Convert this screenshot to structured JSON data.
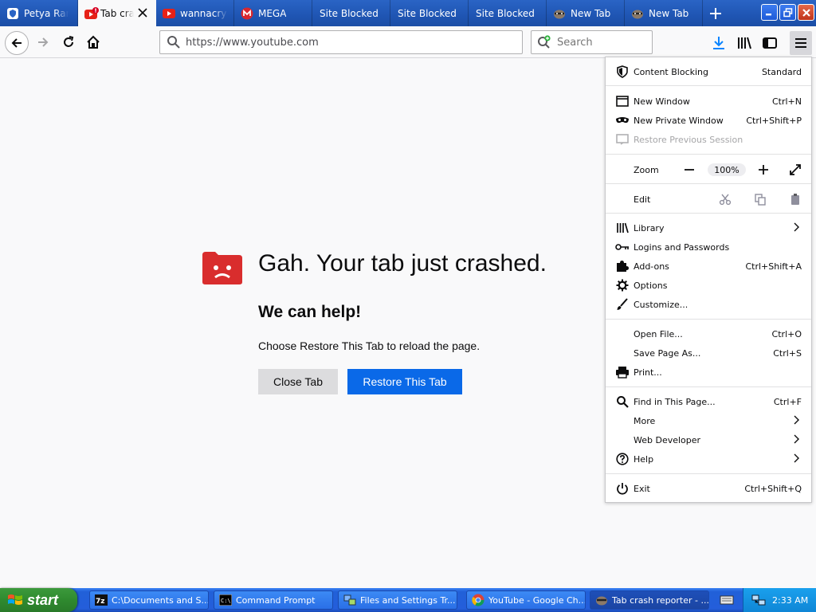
{
  "tabs": [
    {
      "title": "Petya Ransomware",
      "icon": "shield-icon"
    },
    {
      "title": "Tab crashed",
      "icon": "crashed-youtube-icon",
      "active": true
    },
    {
      "title": "wannacry download",
      "icon": "youtube-icon"
    },
    {
      "title": "MEGA",
      "icon": "mega-icon"
    },
    {
      "title": "Site Blocked",
      "icon": ""
    },
    {
      "title": "Site Blocked",
      "icon": ""
    },
    {
      "title": "Site Blocked",
      "icon": ""
    },
    {
      "title": "New Tab",
      "icon": "raccoon-icon"
    },
    {
      "title": "New Tab",
      "icon": "raccoon-icon"
    }
  ],
  "nav": {
    "url": "https://www.youtube.com",
    "search_placeholder": "Search"
  },
  "crash": {
    "title": "Gah. Your tab just crashed.",
    "help": "We can help!",
    "message": "Choose Restore This Tab to reload the page.",
    "close_label": "Close Tab",
    "restore_label": "Restore This Tab"
  },
  "menu": {
    "content_blocking": {
      "label": "Content Blocking",
      "value": "Standard"
    },
    "new_window": {
      "label": "New Window",
      "shortcut": "Ctrl+N"
    },
    "new_private_window": {
      "label": "New Private Window",
      "shortcut": "Ctrl+Shift+P"
    },
    "restore_session": {
      "label": "Restore Previous Session"
    },
    "zoom": {
      "label": "Zoom",
      "value": "100%"
    },
    "edit": {
      "label": "Edit"
    },
    "library": {
      "label": "Library"
    },
    "logins": {
      "label": "Logins and Passwords"
    },
    "addons": {
      "label": "Add-ons",
      "shortcut": "Ctrl+Shift+A"
    },
    "options": {
      "label": "Options"
    },
    "customize": {
      "label": "Customize..."
    },
    "open_file": {
      "label": "Open File...",
      "shortcut": "Ctrl+O"
    },
    "save_page": {
      "label": "Save Page As...",
      "shortcut": "Ctrl+S"
    },
    "print": {
      "label": "Print..."
    },
    "find": {
      "label": "Find in This Page...",
      "shortcut": "Ctrl+F"
    },
    "more": {
      "label": "More"
    },
    "web_developer": {
      "label": "Web Developer"
    },
    "help": {
      "label": "Help"
    },
    "exit": {
      "label": "Exit",
      "shortcut": "Ctrl+Shift+Q"
    }
  },
  "taskbar": {
    "start_label": "start",
    "items": [
      {
        "title": "C:\\Documents and S...",
        "icon": "7zip-icon"
      },
      {
        "title": "Command Prompt",
        "icon": "cmd-icon"
      },
      {
        "title": "Files and Settings Tr...",
        "icon": "migration-icon"
      },
      {
        "title": "YouTube - Google Ch...",
        "icon": "chrome-icon"
      },
      {
        "title": "Tab crash reporter - ...",
        "icon": "firefox-icon",
        "active": true
      }
    ],
    "clock": "2:33 AM"
  },
  "colors": {
    "accent_blue": "#0a69e8",
    "crash_red": "#d92d2d",
    "xp_blue": "#245edb",
    "xp_green": "#3c9a3c"
  }
}
